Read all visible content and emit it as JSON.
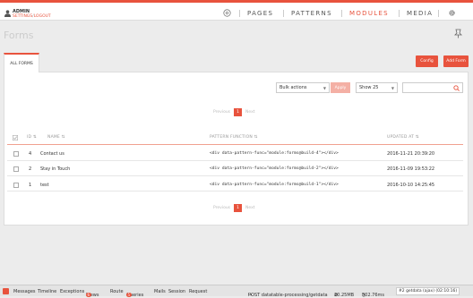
{
  "topbar": {
    "admin_label": "ADMIN",
    "settings_link": "SETTINGS",
    "separator": "/",
    "logout_link": "LOGOUT",
    "nav": [
      "PAGES",
      "PATTERNS",
      "MODULES",
      "MEDIA"
    ],
    "active_nav": "MODULES"
  },
  "page": {
    "title": "Forms"
  },
  "tabs": {
    "all_forms": "ALL FORMS"
  },
  "toolbar": {
    "config_label": "Config",
    "add_form_label": "Add Form"
  },
  "filters": {
    "bulk_actions": "Bulk actions",
    "apply_label": "Apply",
    "show_count": "Show 25",
    "search_placeholder": ""
  },
  "pagination": {
    "previous": "Previous",
    "current_page": "1",
    "next": "Next"
  },
  "table": {
    "headers": {
      "id": "ID",
      "name": "NAME",
      "pattern_function": "PATTERN FUNCTION",
      "updated_at": "UPDATED AT"
    },
    "rows": [
      {
        "id": "4",
        "name": "Contact us",
        "pattern": "<div data-pattern-func=\"module:forms@build-4\"></div>",
        "updated": "2016-11-21 20:39:20"
      },
      {
        "id": "2",
        "name": "Stay in Touch",
        "pattern": "<div data-pattern-func=\"module:forms@build-2\"></div>",
        "updated": "2016-11-09 19:53:22"
      },
      {
        "id": "1",
        "name": "test",
        "pattern": "<div data-pattern-func=\"module:forms@build-1\"></div>",
        "updated": "2016-10-10 14:25:45"
      }
    ]
  },
  "debugbar": {
    "messages": "Messages",
    "timeline": "Timeline",
    "exceptions": "Exceptions",
    "views": "Views",
    "views_count": "6",
    "route": "Route",
    "queries": "Queries",
    "queries_count": "5",
    "mails": "Mails",
    "session": "Session",
    "request": "Request",
    "request_info": "POST datatable-processing/getdata",
    "memory": "20.25MB",
    "time": "502.76ms",
    "ajax": "#2 getdata (ajax) (02:10:16)"
  },
  "colors": {
    "accent": "#e8533d",
    "background": "#ececec"
  }
}
